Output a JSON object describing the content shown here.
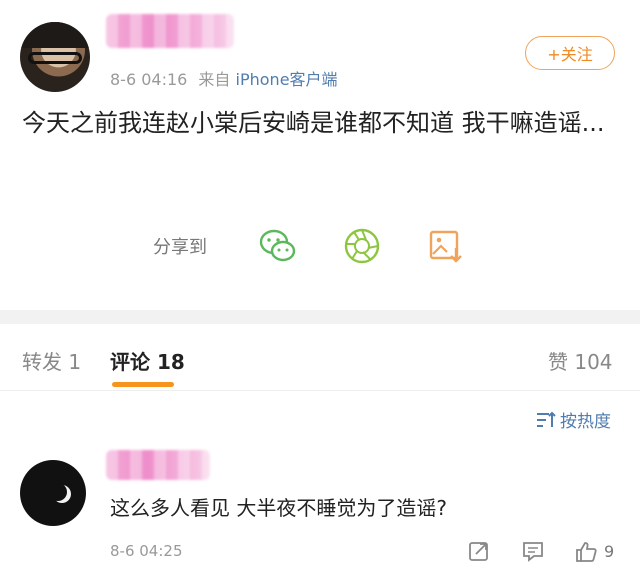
{
  "post": {
    "timestamp": "8-6 04:16",
    "source_prefix": "来自",
    "source": "iPhone客户端",
    "follow_label": "+关注",
    "content": "今天之前我连赵小棠后安崎是谁都不知道 我干嘛造谣...",
    "share_label": "分享到"
  },
  "tabs": [
    {
      "label": "转发 1"
    },
    {
      "label": "评论 18"
    },
    {
      "label": "赞 104"
    }
  ],
  "sort_label": "按热度",
  "comment": {
    "text": "这么多人看见 大半夜不睡觉为了造谣?",
    "timestamp": "8-6 04:25",
    "likes": "9"
  },
  "colors": {
    "accent": "#f7941d",
    "link": "#507daf",
    "follow": "#f08a24"
  },
  "icons": [
    "wechat-icon",
    "moments-icon",
    "save-image-icon",
    "sort-icon",
    "repost-icon",
    "comment-icon",
    "thumbs-up-icon"
  ]
}
